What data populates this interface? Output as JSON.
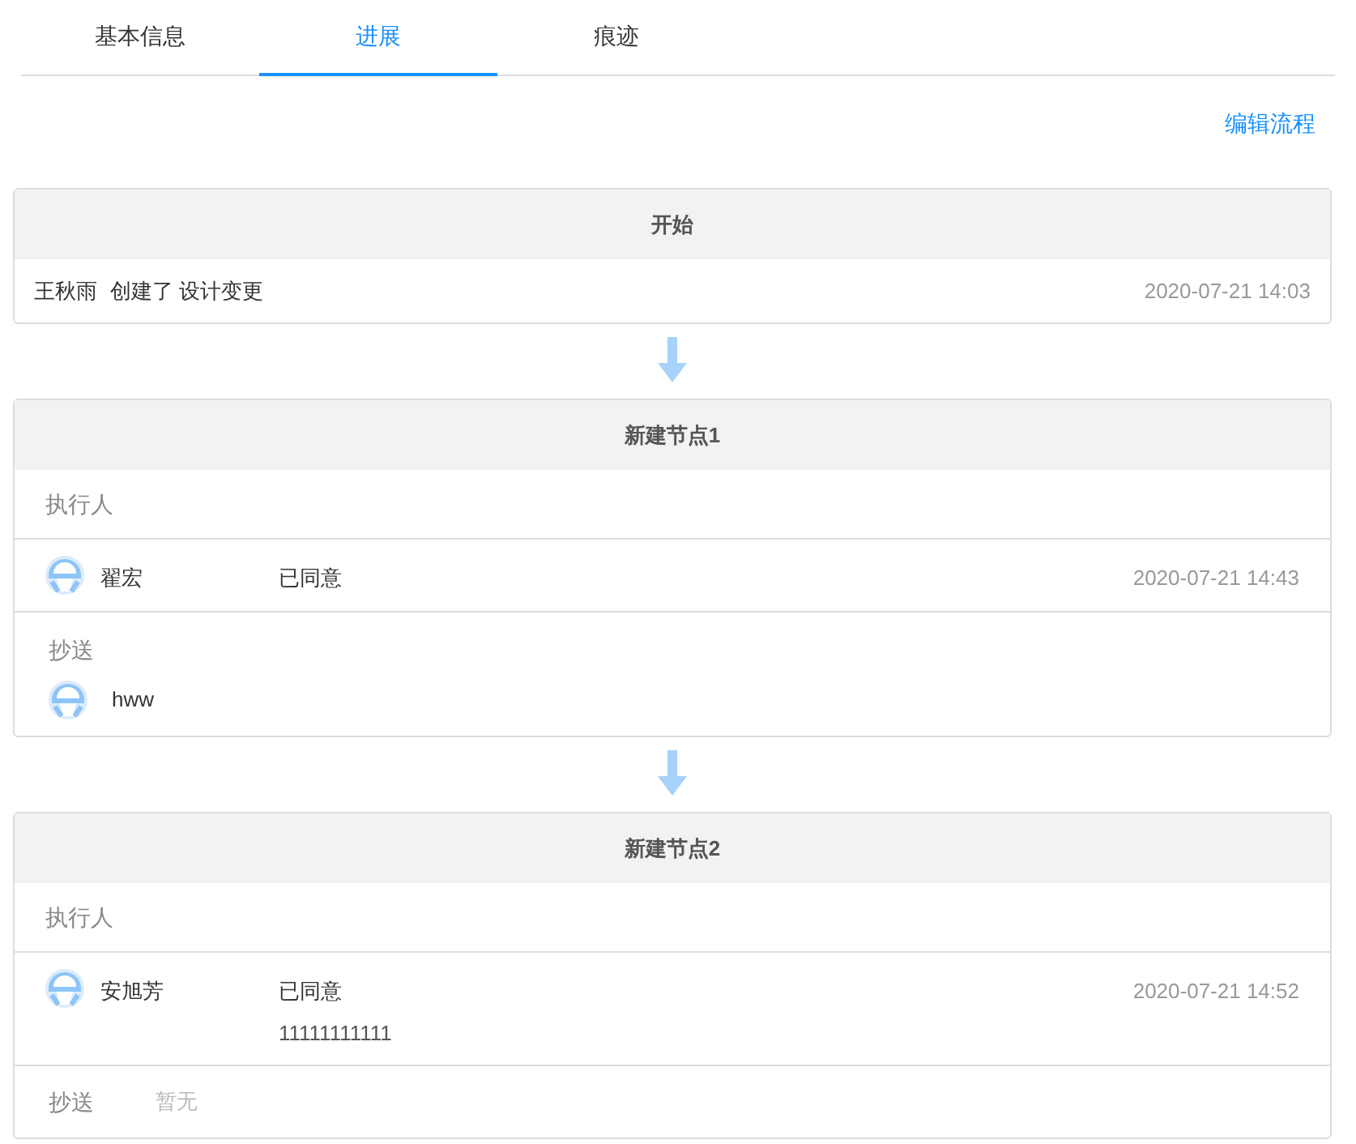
{
  "tabs": [
    {
      "label": "基本信息",
      "selected": false
    },
    {
      "label": "进展",
      "selected": true
    },
    {
      "label": "痕迹",
      "selected": false
    }
  ],
  "edit_link": "编辑流程",
  "nodes": [
    {
      "kind": "start",
      "title": "开始",
      "user": "王秋雨",
      "action": "创建了 设计变更",
      "timestamp": "2020-07-21 14:03"
    },
    {
      "kind": "approval",
      "title": "新建节点1",
      "executor_label": "执行人",
      "executors": [
        {
          "name": "翟宏",
          "status": "已同意",
          "timestamp": "2020-07-21 14:43"
        }
      ],
      "cc_label": "抄送",
      "cc": [
        {
          "name": "hww"
        }
      ]
    },
    {
      "kind": "approval",
      "title": "新建节点2",
      "executor_label": "执行人",
      "executors": [
        {
          "name": "安旭芳",
          "status": "已同意",
          "comment": "11111111111",
          "timestamp": "2020-07-21 14:52"
        }
      ],
      "cc_label": "抄送",
      "cc_empty": "暂无"
    }
  ]
}
